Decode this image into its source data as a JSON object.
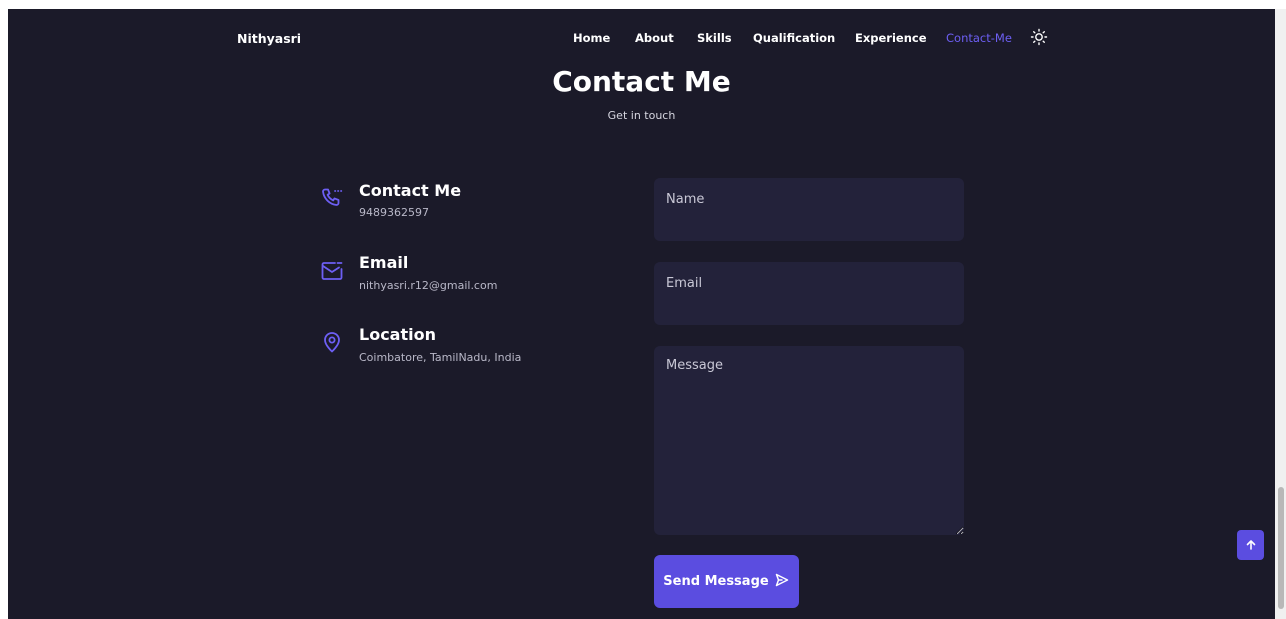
{
  "brand": "Nithyasri",
  "nav": {
    "items": [
      {
        "label": "Home"
      },
      {
        "label": "About"
      },
      {
        "label": "Skills"
      },
      {
        "label": "Qualification"
      },
      {
        "label": "Experience"
      },
      {
        "label": "Contact-Me",
        "active": true
      }
    ],
    "theme_icon": "sun-icon"
  },
  "section": {
    "title": "Contact Me",
    "subtitle": "Get in touch"
  },
  "contact_info": [
    {
      "icon": "phone-icon",
      "title": "Contact Me",
      "text": "9489362597"
    },
    {
      "icon": "mail-icon",
      "title": "Email",
      "text": "nithyasri.r12@gmail.com"
    },
    {
      "icon": "location-pin-icon",
      "title": "Location",
      "text": "Coimbatore, TamilNadu, India"
    }
  ],
  "form": {
    "name_placeholder": "Name",
    "name_value": "",
    "email_placeholder": "Email",
    "email_value": "",
    "message_placeholder": "Message",
    "message_value": "",
    "submit_label": "Send Message",
    "submit_icon": "send-icon"
  },
  "scroll_up_icon": "arrow-up-icon",
  "colors": {
    "background": "#1b1a29",
    "accent": "#5b4de0",
    "field_background": "#23223a",
    "text": "#ffffff"
  }
}
